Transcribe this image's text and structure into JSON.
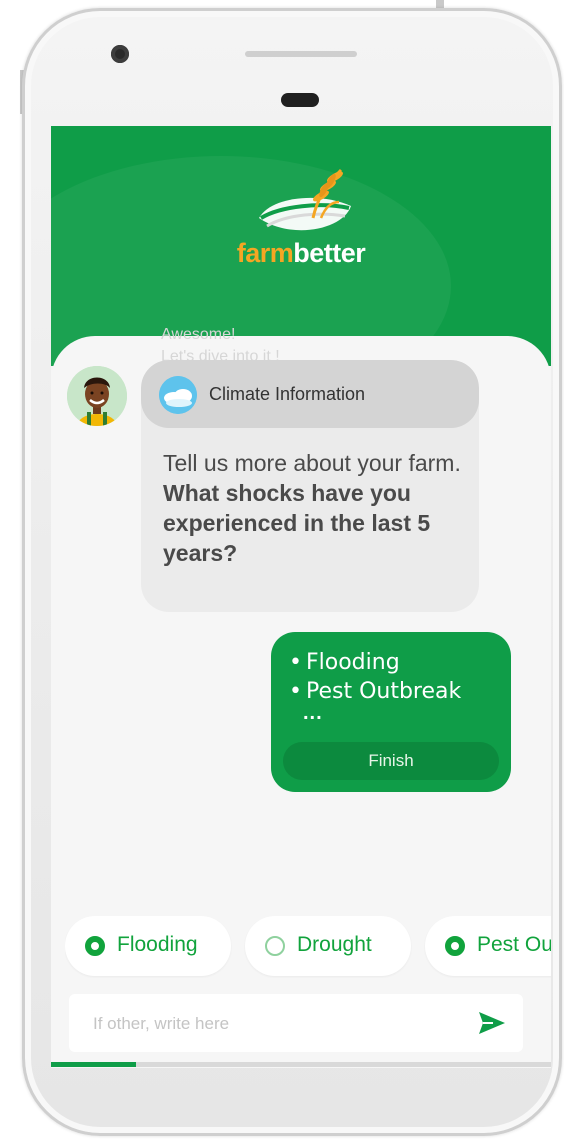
{
  "colors": {
    "brand_green": "#0f9d48",
    "brand_orange": "#f5a623",
    "bubble_grey": "#ebebeb"
  },
  "header": {
    "logo_icon": "wheat-field-logo-icon",
    "brand_part1": "farm",
    "brand_part2": "better"
  },
  "chat": {
    "faded_previous_line1": "Awesome!",
    "faded_previous_line2": "Let's dive into it !",
    "bot": {
      "avatar_icon": "farmer-avatar-icon",
      "topic_icon": "cloud-icon",
      "topic_label": "Climate Information",
      "message": "Tell us more about your farm.",
      "question": "What shocks have you experienced in the last 5 years?"
    },
    "user": {
      "answers": [
        "Flooding",
        "Pest Outbreak"
      ],
      "more": "...",
      "finish_label": "Finish"
    }
  },
  "options": [
    {
      "label": "Flooding",
      "selected": true
    },
    {
      "label": "Drought",
      "selected": false
    },
    {
      "label": "Pest Outbreak",
      "selected": true
    }
  ],
  "input": {
    "placeholder": "If other, write here",
    "value": "",
    "send_icon": "send-arrow-icon"
  },
  "progress": {
    "fraction": 0.17
  }
}
